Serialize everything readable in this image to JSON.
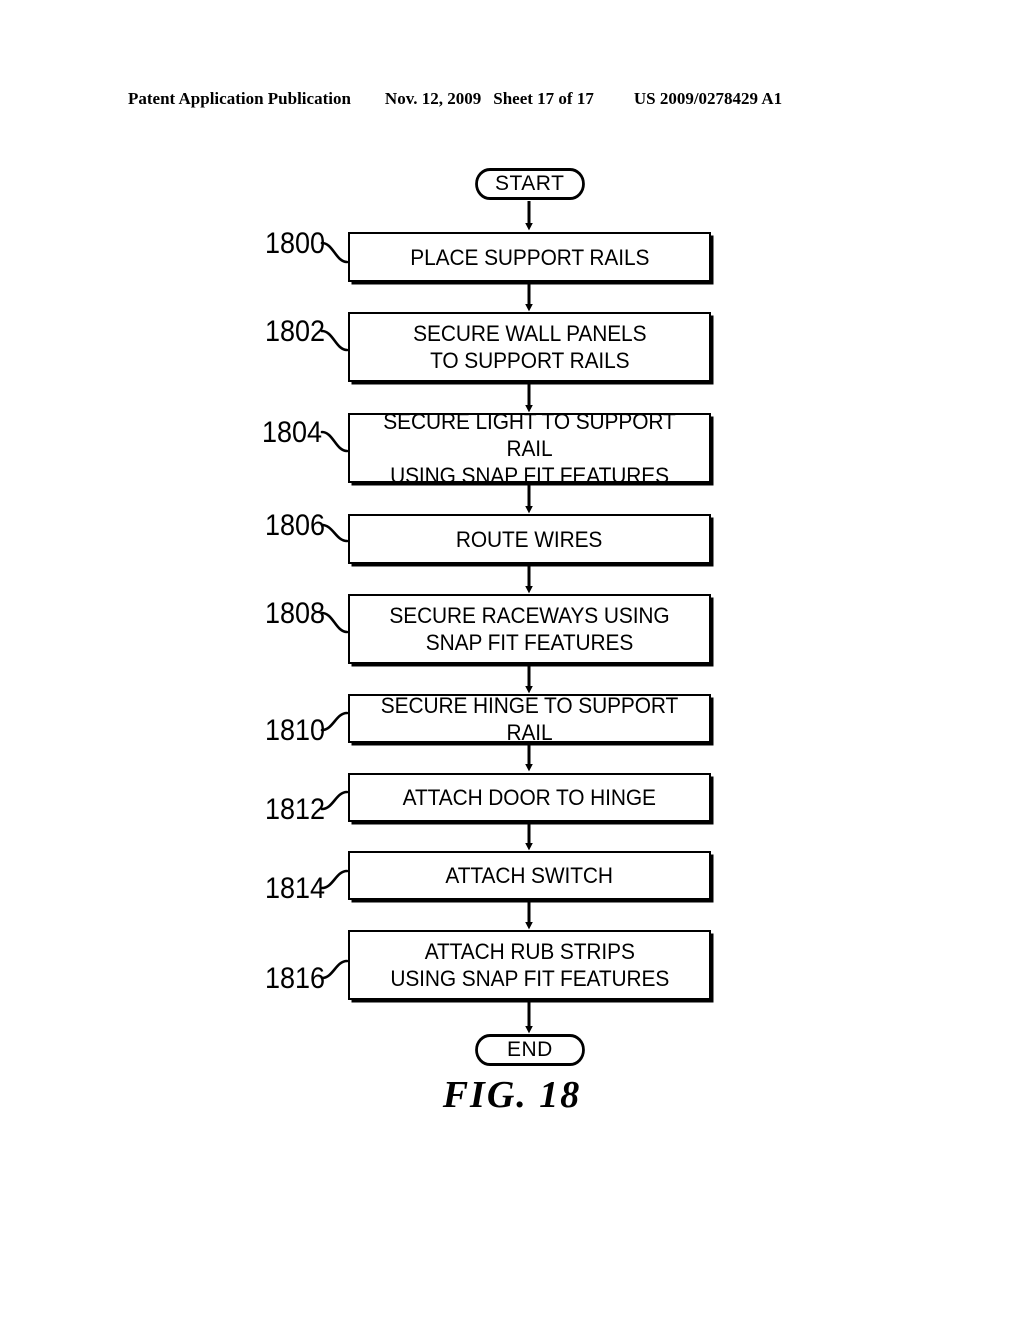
{
  "header": {
    "publication": "Patent Application Publication",
    "date": "Nov. 12, 2009",
    "sheet": "Sheet 17 of 17",
    "patent_number": "US 2009/0278429 A1"
  },
  "figure": {
    "caption": "FIG. 18",
    "start_label": "START",
    "end_label": "END"
  },
  "steps": [
    {
      "ref": "1800",
      "text": "PLACE SUPPORT RAILS"
    },
    {
      "ref": "1802",
      "text": "SECURE WALL PANELS\nTO SUPPORT RAILS"
    },
    {
      "ref": "1804",
      "text": "SECURE LIGHT TO SUPPORT RAIL\nUSING SNAP FIT FEATURES"
    },
    {
      "ref": "1806",
      "text": "ROUTE WIRES"
    },
    {
      "ref": "1808",
      "text": "SECURE RACEWAYS USING\nSNAP FIT FEATURES"
    },
    {
      "ref": "1810",
      "text": "SECURE HINGE TO SUPPORT RAIL"
    },
    {
      "ref": "1812",
      "text": "ATTACH DOOR TO HINGE"
    },
    {
      "ref": "1814",
      "text": "ATTACH SWITCH"
    },
    {
      "ref": "1816",
      "text": "ATTACH RUB STRIPS\nUSING SNAP FIT FEATURES"
    }
  ],
  "colors": {
    "ink": "#000000",
    "paper": "#ffffff"
  }
}
